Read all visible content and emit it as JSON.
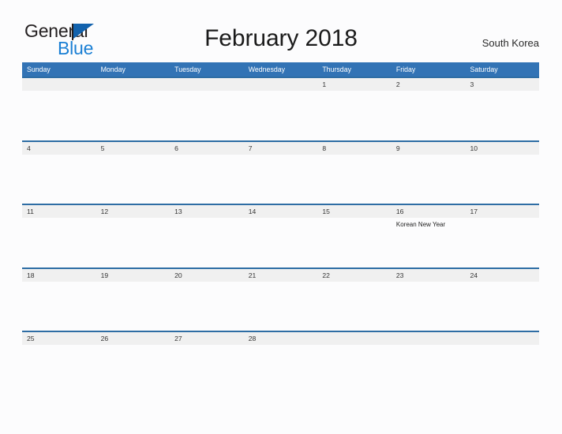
{
  "brand": {
    "name_part1": "General",
    "name_part2": "Blue",
    "flag_icon": "blue-triangle-flag",
    "color_dark": "#231f20",
    "color_blue": "#1a7fd4",
    "color_flag": "#1262ad"
  },
  "header": {
    "title": "February 2018",
    "country": "South Korea"
  },
  "calendar": {
    "month": "February",
    "year": "2018",
    "accent_header_color": "#3273b5",
    "row_border_color": "#2e6da4",
    "date_strip_color": "#f0f0f0",
    "weekdays": [
      "Sunday",
      "Monday",
      "Tuesday",
      "Wednesday",
      "Thursday",
      "Friday",
      "Saturday"
    ],
    "weeks": [
      [
        {
          "date": "",
          "event": ""
        },
        {
          "date": "",
          "event": ""
        },
        {
          "date": "",
          "event": ""
        },
        {
          "date": "",
          "event": ""
        },
        {
          "date": "1",
          "event": ""
        },
        {
          "date": "2",
          "event": ""
        },
        {
          "date": "3",
          "event": ""
        }
      ],
      [
        {
          "date": "4",
          "event": ""
        },
        {
          "date": "5",
          "event": ""
        },
        {
          "date": "6",
          "event": ""
        },
        {
          "date": "7",
          "event": ""
        },
        {
          "date": "8",
          "event": ""
        },
        {
          "date": "9",
          "event": ""
        },
        {
          "date": "10",
          "event": ""
        }
      ],
      [
        {
          "date": "11",
          "event": ""
        },
        {
          "date": "12",
          "event": ""
        },
        {
          "date": "13",
          "event": ""
        },
        {
          "date": "14",
          "event": ""
        },
        {
          "date": "15",
          "event": ""
        },
        {
          "date": "16",
          "event": "Korean New Year"
        },
        {
          "date": "17",
          "event": ""
        }
      ],
      [
        {
          "date": "18",
          "event": ""
        },
        {
          "date": "19",
          "event": ""
        },
        {
          "date": "20",
          "event": ""
        },
        {
          "date": "21",
          "event": ""
        },
        {
          "date": "22",
          "event": ""
        },
        {
          "date": "23",
          "event": ""
        },
        {
          "date": "24",
          "event": ""
        }
      ],
      [
        {
          "date": "25",
          "event": ""
        },
        {
          "date": "26",
          "event": ""
        },
        {
          "date": "27",
          "event": ""
        },
        {
          "date": "28",
          "event": ""
        },
        {
          "date": "",
          "event": ""
        },
        {
          "date": "",
          "event": ""
        },
        {
          "date": "",
          "event": ""
        }
      ]
    ]
  }
}
